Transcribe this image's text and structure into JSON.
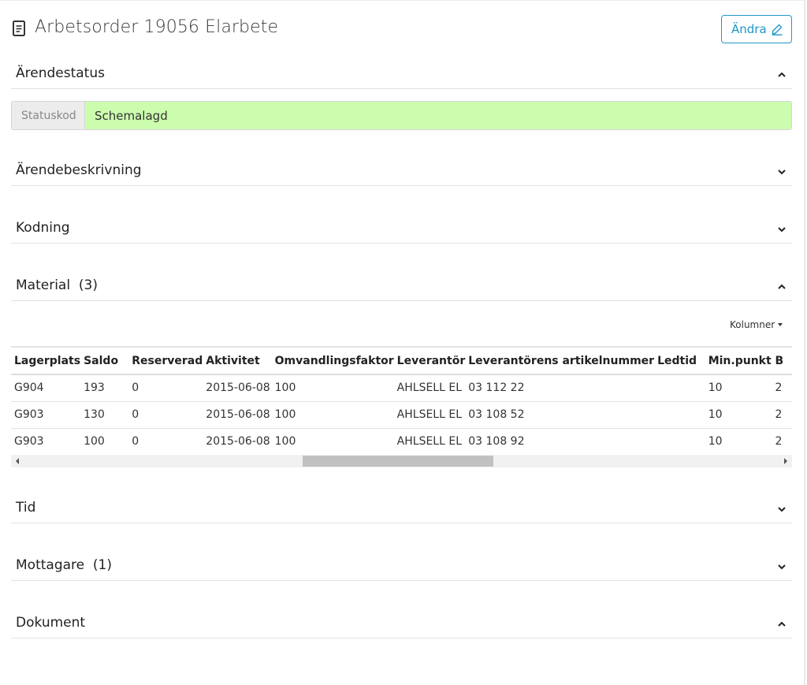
{
  "header": {
    "title": "Arbetsorder 19056 Elarbete",
    "title_icon": "document-icon",
    "edit_label": "Ändra",
    "edit_icon": "pencil-icon"
  },
  "sections": {
    "status": {
      "label": "Ärendestatus",
      "expanded": true
    },
    "description": {
      "label": "Ärendebeskrivning",
      "expanded": false
    },
    "coding": {
      "label": "Kodning",
      "expanded": false
    },
    "material": {
      "label": "Material  (3)",
      "expanded": true
    },
    "time": {
      "label": "Tid",
      "expanded": false
    },
    "recipients": {
      "label": "Mottagare  (1)",
      "expanded": false
    },
    "documents": {
      "label": "Dokument",
      "expanded": true
    }
  },
  "status": {
    "label": "Statuskod",
    "value": "Schemalagd",
    "value_color": "#ccfdaf"
  },
  "material": {
    "columns_label": "Kolumner",
    "headers": [
      "Lagerplats",
      "Saldo",
      "Reserverad",
      "Aktivitet",
      "Omvandlingsfaktor",
      "Leverantör",
      "Leverantörens artikelnummer",
      "Ledtid",
      "Min.punkt",
      "B"
    ],
    "rows": [
      [
        "G904",
        "193",
        "0",
        "2015-06-08",
        "100",
        "AHLSELL EL",
        "03 112 22",
        "",
        "10",
        "2"
      ],
      [
        "G903",
        "130",
        "0",
        "2015-06-08",
        "100",
        "AHLSELL EL",
        "03 108 52",
        "",
        "10",
        "2"
      ],
      [
        "G903",
        "100",
        "0",
        "2015-06-08",
        "100",
        "AHLSELL EL",
        "03 108 92",
        "",
        "10",
        "2"
      ]
    ]
  },
  "colors": {
    "accent": "#1f97c8",
    "status_bg": "#ccfdaf"
  }
}
